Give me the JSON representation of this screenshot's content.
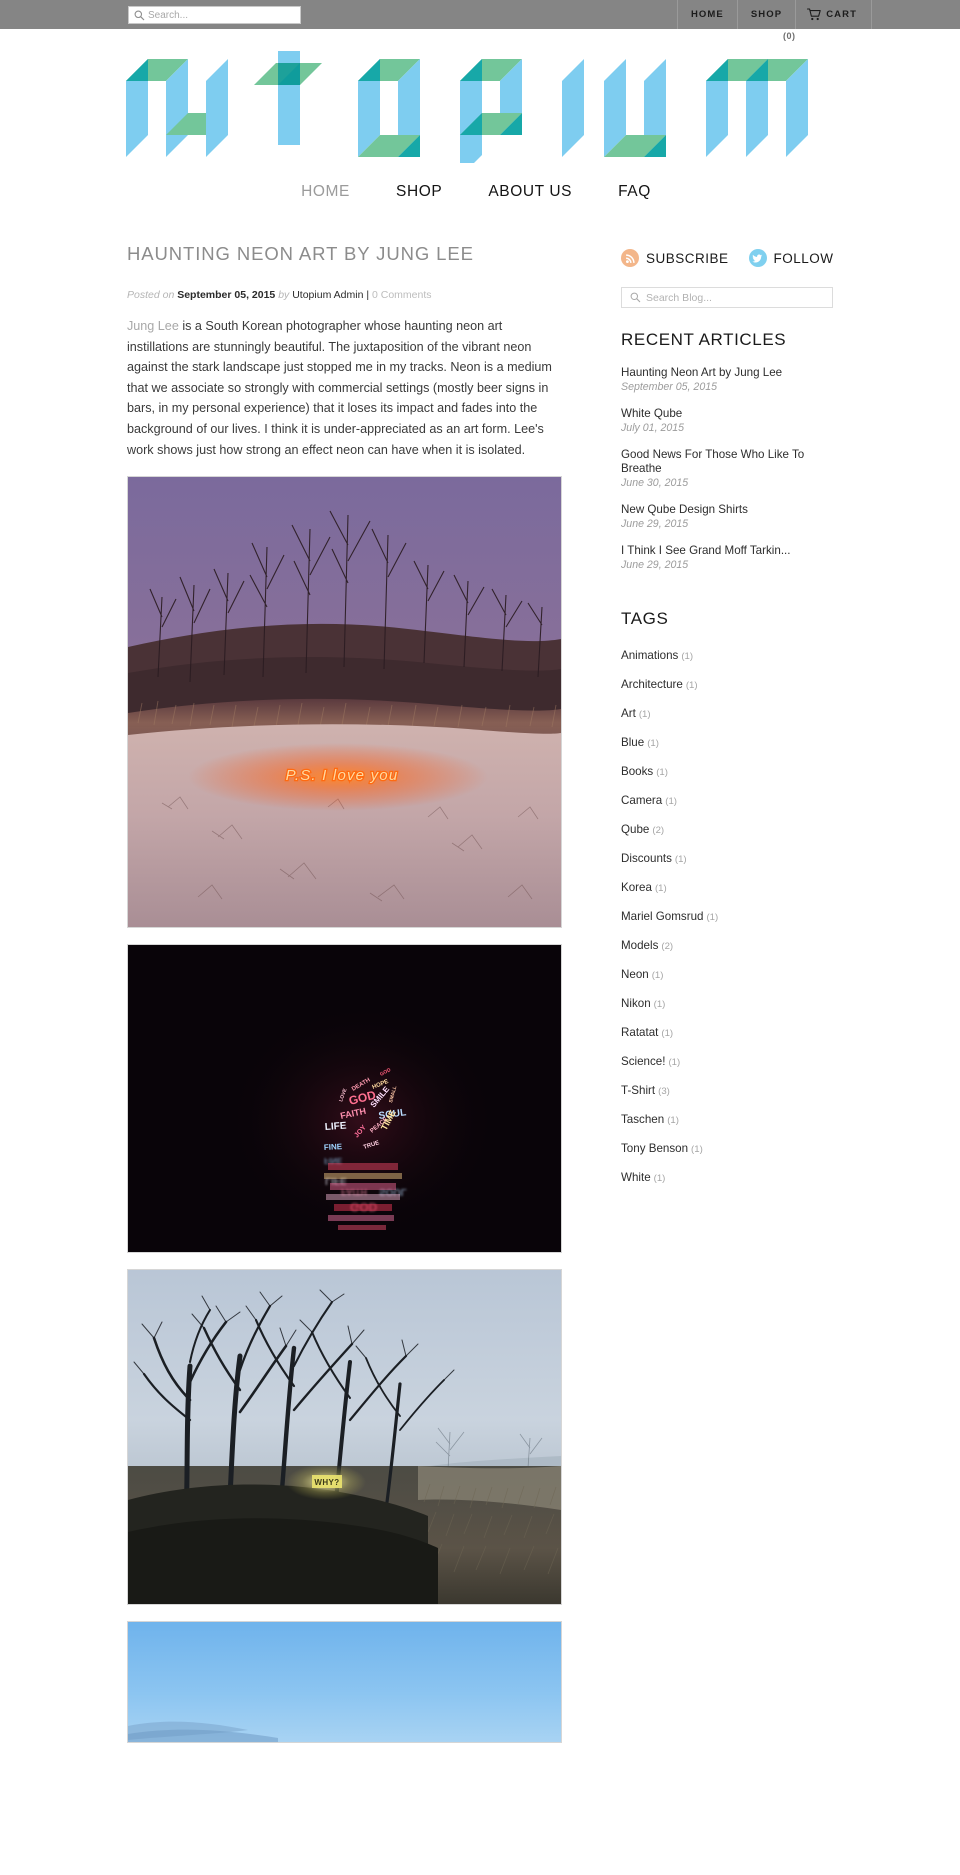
{
  "topbar": {
    "search": {
      "placeholder": "Search...",
      "value": "",
      "icon": "search-icon"
    },
    "nav": [
      {
        "label": "HOME",
        "name": "topnav-home"
      },
      {
        "label": "SHOP",
        "name": "topnav-shop"
      }
    ],
    "cart": {
      "label": "CART",
      "icon": "shopping-cart-icon",
      "count": "(0)"
    }
  },
  "logo": {
    "text": "utopium",
    "colors": {
      "blue": "#7ecdf0",
      "green": "#73c69a",
      "teal": "#17a8a8",
      "dark_teal": "#0e9a9a"
    }
  },
  "mainnav": [
    {
      "label": "HOME",
      "active": true
    },
    {
      "label": "SHOP",
      "active": false
    },
    {
      "label": "ABOUT US",
      "active": false
    },
    {
      "label": "FAQ",
      "active": false
    }
  ],
  "article": {
    "title": "HAUNTING NEON ART BY JUNG LEE",
    "meta": {
      "posted_on": "Posted on",
      "date": "September 05, 2015",
      "by": "by",
      "author": "Utopium Admin",
      "separator": "|",
      "comments": "0 Comments"
    },
    "body_link": "Jung Lee",
    "body": " is a South Korean photographer whose haunting neon art instillations are stunningly beautiful. The juxtaposition of the vibrant neon against the stark landscape just stopped me in my tracks. Neon is a medium that we associate so strongly with commercial settings (mostly beer signs in bars, in my personal experience) that it loses its impact and fades into the background of our lives. I think it is under-appreciated as an art form. Lee's work shows just how strong an effect neon can have when it is isolated.",
    "photos": [
      {
        "name": "photo-ps-i-love-you",
        "neon_text": "P.S.  I love  you",
        "description": "Purple twilight over snowy dune with bare branches and orange neon script"
      },
      {
        "name": "photo-neon-word-cluster",
        "neon_text": "GOD FAITH LIFE SOUL LOVE DEATH",
        "description": "Dark night, cluster of colored neon words reflected in water"
      },
      {
        "name": "photo-why",
        "neon_text": "WHY?",
        "description": "Misty blue forest with bare trees and small yellow neon sign"
      },
      {
        "name": "photo-blue-sky",
        "neon_text": "",
        "description": "Pale blue sky over distant hazy mountains"
      }
    ]
  },
  "sidebar": {
    "social": [
      {
        "label": "SUBSCRIBE",
        "icon": "rss-icon",
        "color": "#f3b68a"
      },
      {
        "label": "FOLLOW",
        "icon": "twitter-icon",
        "color": "#7fd0ef"
      }
    ],
    "blog_search": {
      "placeholder": "Search Blog...",
      "value": "",
      "icon": "search-icon"
    },
    "recent_heading": "RECENT ARTICLES",
    "recent_articles": [
      {
        "title": "Haunting Neon Art by Jung Lee",
        "date": "September 05, 2015"
      },
      {
        "title": "White Qube",
        "date": "July 01, 2015"
      },
      {
        "title": "Good News For Those Who Like To Breathe",
        "date": "June 30, 2015"
      },
      {
        "title": "New Qube Design Shirts",
        "date": "June 29, 2015"
      },
      {
        "title": "I Think I See Grand Moff Tarkin...",
        "date": "June 29, 2015"
      }
    ],
    "tags_heading": "TAGS",
    "tags": [
      {
        "name": "Animations",
        "count": "(1)"
      },
      {
        "name": "Architecture",
        "count": "(1)"
      },
      {
        "name": "Art",
        "count": "(1)"
      },
      {
        "name": "Blue",
        "count": "(1)"
      },
      {
        "name": "Books",
        "count": "(1)"
      },
      {
        "name": "Camera",
        "count": "(1)"
      },
      {
        "name": "Qube",
        "count": "(2)"
      },
      {
        "name": "Discounts",
        "count": "(1)"
      },
      {
        "name": "Korea",
        "count": "(1)"
      },
      {
        "name": "Mariel Gomsrud",
        "count": "(1)"
      },
      {
        "name": "Models",
        "count": "(2)"
      },
      {
        "name": "Neon",
        "count": "(1)"
      },
      {
        "name": "Nikon",
        "count": "(1)"
      },
      {
        "name": "Ratatat",
        "count": "(1)"
      },
      {
        "name": "Science!",
        "count": "(1)"
      },
      {
        "name": "T-Shirt",
        "count": "(3)"
      },
      {
        "name": "Taschen",
        "count": "(1)"
      },
      {
        "name": "Tony Benson",
        "count": "(1)"
      },
      {
        "name": "White",
        "count": "(1)"
      }
    ]
  }
}
